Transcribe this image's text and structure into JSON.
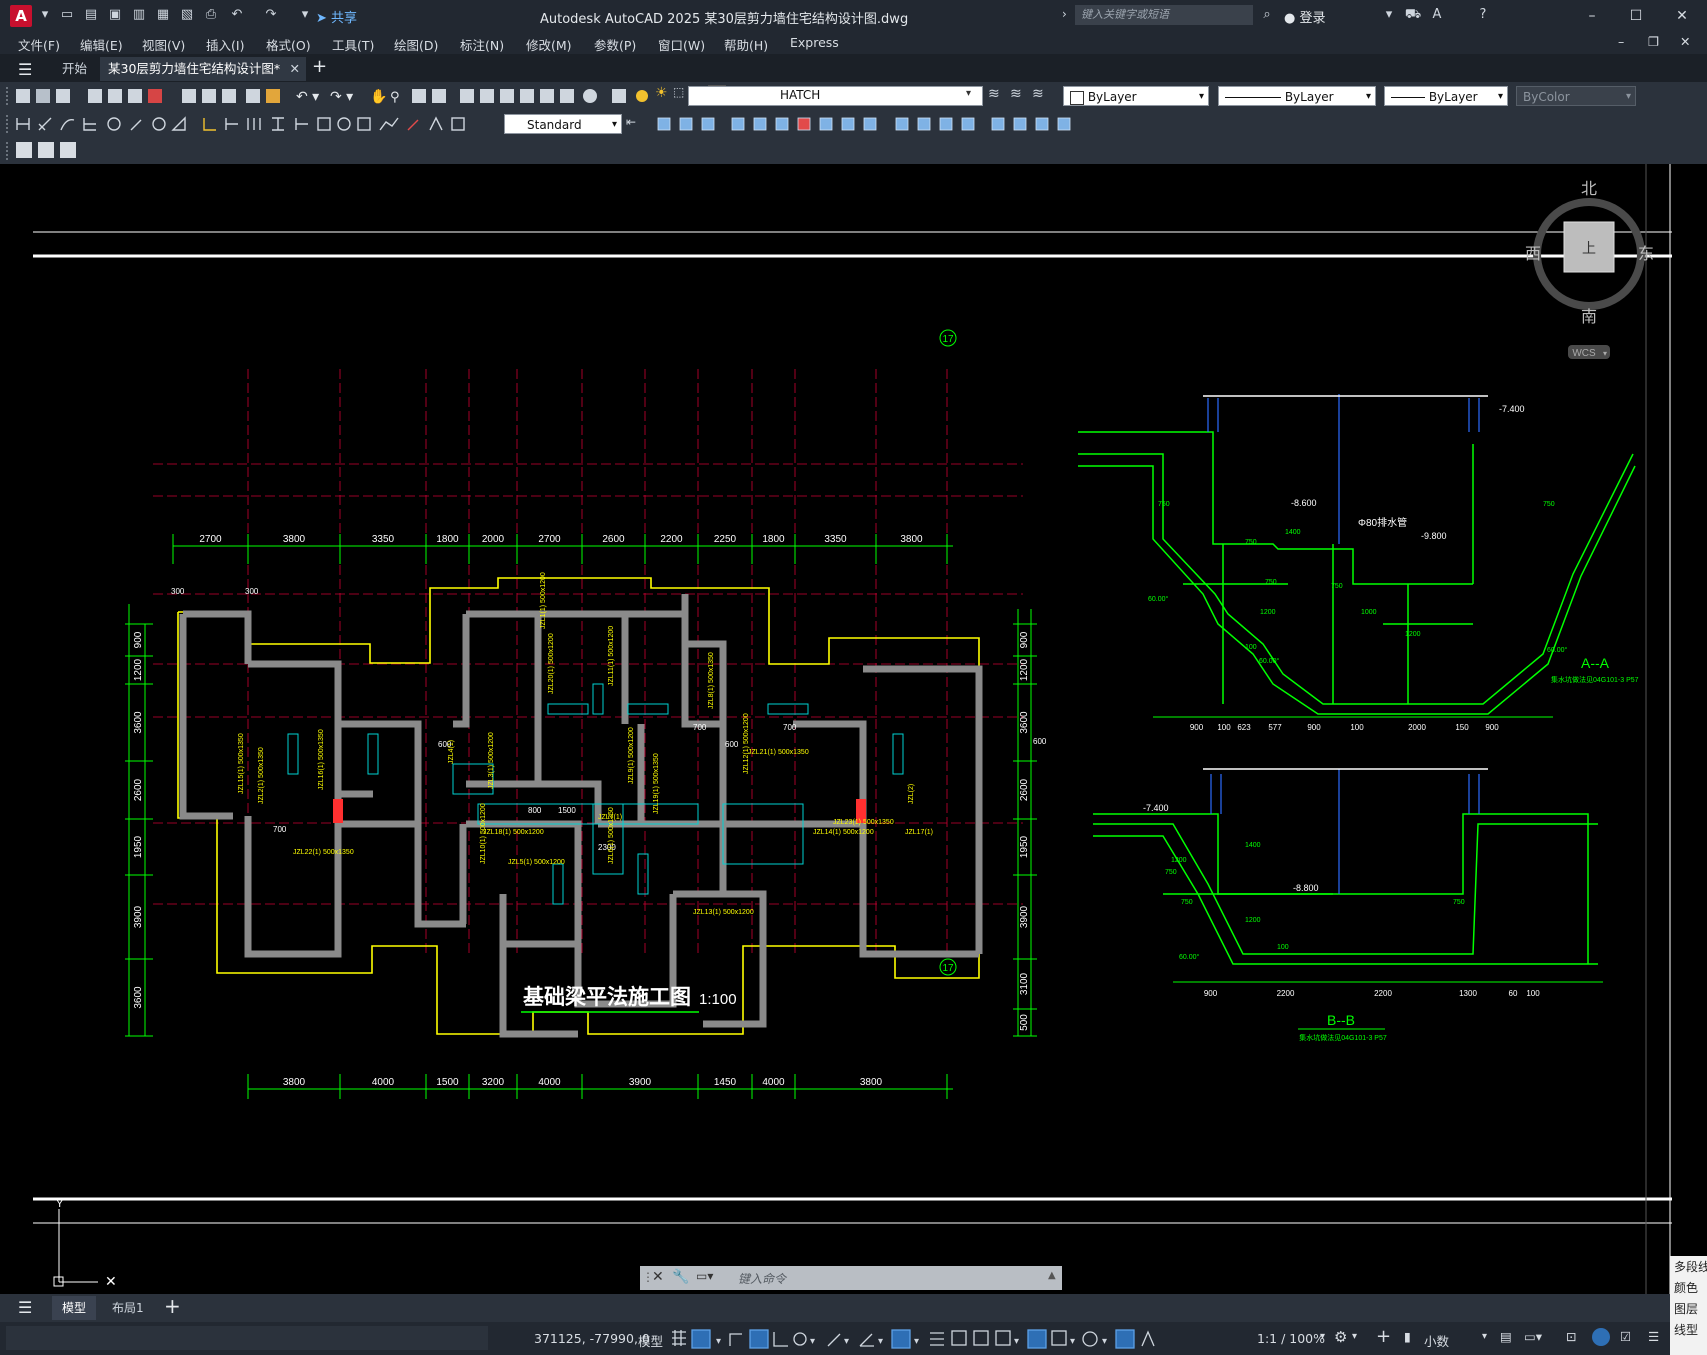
{
  "app": {
    "title": "Autodesk AutoCAD 2025    某30层剪力墙住宅结构设计图.dwg",
    "logo": "A",
    "share_label": "共享",
    "search_placeholder": "键入关键字或短语",
    "login_label": "登录"
  },
  "menu": [
    "文件(F)",
    "编辑(E)",
    "视图(V)",
    "插入(I)",
    "格式(O)",
    "工具(T)",
    "绘图(D)",
    "标注(N)",
    "修改(M)",
    "参数(P)",
    "窗口(W)",
    "帮助(H)",
    "Express"
  ],
  "tabs": {
    "start": "开始",
    "doc": "某30层剪力墙住宅结构设计图*"
  },
  "toolbar": {
    "layer_value": "HATCH",
    "color_value": "ByLayer",
    "linetype_value": "ByLayer",
    "lineweight_value": "ByLayer",
    "plotstyle_value": "ByColor",
    "textstyle_value": "Standard"
  },
  "viewcube": {
    "north": "北",
    "south": "南",
    "west": "西",
    "east": "东",
    "top": "上",
    "wcs": "WCS"
  },
  "drawing": {
    "title": "基础梁平法施工图",
    "scale": "1:100",
    "axis_label": "17",
    "top_dims": [
      "2700",
      "3800",
      "3350",
      "1800",
      "2000",
      "2700",
      "2600",
      "2200",
      "2250",
      "1800",
      "3350",
      "3800"
    ],
    "bottom_dims": [
      "3800",
      "4000",
      "1500",
      "3200",
      "4000",
      "3900",
      "1450",
      "4000",
      "3800"
    ],
    "left_dims": [
      "900",
      "1200",
      "3600",
      "2600",
      "1950",
      "3900",
      "3600"
    ],
    "right_dims": [
      "900",
      "1200",
      "3600",
      "2600",
      "1950",
      "3900",
      "3100",
      "500"
    ],
    "small_dims": [
      "300",
      "300",
      "600",
      "600",
      "600",
      "700",
      "700",
      "700",
      "800",
      "1500",
      "2300"
    ],
    "section_aa": "A--A",
    "section_bb": "B--B",
    "section_note_a": "集水坑做法见04G101-3 P57",
    "section_note_b": "集水坑做法见04G101-3 P57",
    "elev_1": "-7.400",
    "elev_2": "-8.600",
    "elev_3": "-9.800",
    "elev_4": "-7.400",
    "elev_5": "-8.800",
    "pipe_label": "Φ80排水管",
    "aa_bottom_dims": [
      "900",
      "100",
      "623",
      "577",
      "900",
      "100",
      "2000",
      "150",
      "900"
    ],
    "bb_bottom_dims": [
      "900",
      "2200",
      "2200",
      "1300",
      "60",
      "100"
    ],
    "aa_small": [
      "750",
      "750",
      "750",
      "750",
      "750",
      "1400",
      "1200",
      "1000",
      "1200",
      "100",
      "60.00°",
      "60.00°",
      "60.00°"
    ],
    "bb_small": [
      "750",
      "750",
      "750",
      "1400",
      "1200",
      "1200",
      "100",
      "60.00°"
    ],
    "beam_labels": [
      "JZL1(1) 500x1200",
      "JZL2(1) 500x1350",
      "JZL3(1) 500x1200",
      "JZL4(1)",
      "JZL5(1) 500x1200",
      "JZL6(1) 500x1350",
      "JZL7(1)",
      "JZL8(1) 500x1350",
      "JZL9(1) 500x1200",
      "JZL10(1) 500x1200",
      "JZL11(1) 500x1200",
      "JZL12(1) 500x1200",
      "JZL13(1) 500x1200",
      "JZL14(1) 500x1200",
      "JZL15(1) 500x1350",
      "JZL16(1) 500x1350",
      "JZL17(1)",
      "JZL18(1) 500x1200",
      "JZL19(1) 500x1350",
      "JZL20(1) 500x1200",
      "JZL21(1) 500x1350",
      "JZL22(1) 500x1350",
      "JZL23(1) 500x1350",
      "JZL(2)"
    ]
  },
  "cmdline": {
    "placeholder": "键入命令"
  },
  "layouts": {
    "model": "模型",
    "layout1": "布局1"
  },
  "status": {
    "coords": "371125, -77990, 0",
    "mode": "模型",
    "scale": "1:1 / 100%",
    "units": "小数"
  },
  "right_popup": [
    "多段线",
    "颜色",
    "图层",
    "线型"
  ],
  "colors": {
    "accent": "#c8102e",
    "wall": "#8a8a8a",
    "dim": "#00ff00",
    "beam_text": "#ffff00",
    "outline": "#ffff00",
    "cyan": "#00d2d2",
    "axis": "#cc0033"
  }
}
